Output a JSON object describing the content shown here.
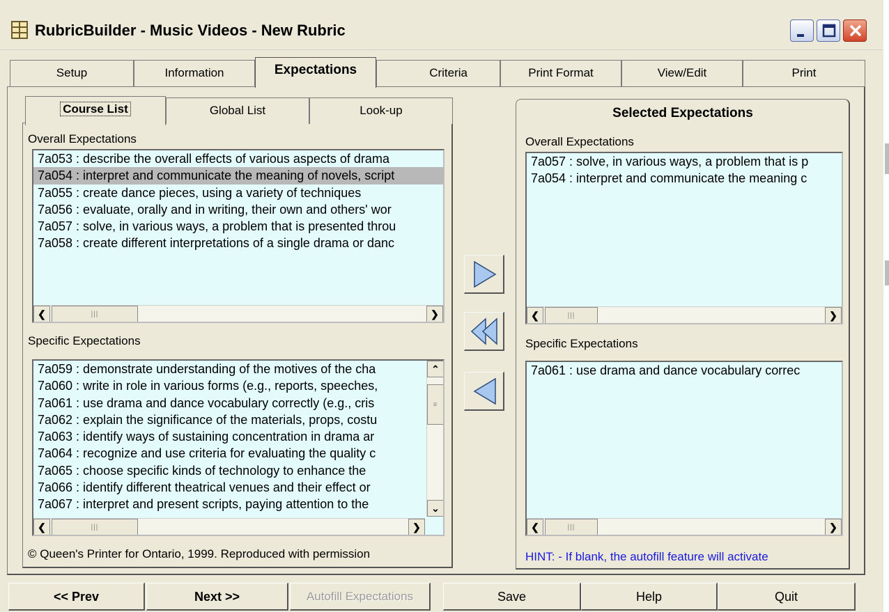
{
  "window": {
    "title": "RubricBuilder  - Music Videos - New Rubric",
    "icon": "app-grid-icon"
  },
  "main_tabs": [
    {
      "label": "Setup"
    },
    {
      "label": "Information"
    },
    {
      "label": "Expectations",
      "active": true
    },
    {
      "label": "Criteria"
    },
    {
      "label": "Print Format"
    },
    {
      "label": "View/Edit"
    },
    {
      "label": "Print"
    }
  ],
  "sub_tabs": [
    {
      "label": "Course List",
      "active": true
    },
    {
      "label": "Global List"
    },
    {
      "label": "Look-up"
    }
  ],
  "left": {
    "overall_label": "Overall Expectations",
    "overall_items": [
      "7a053 : describe the overall effects of various aspects of drama",
      "7a054 : interpret and communicate the meaning of novels, script",
      "7a055 : create dance pieces, using a variety of techniques",
      "7a056 : evaluate, orally and in writing, their own and others' wor",
      "7a057 : solve, in various ways, a problem that is presented throu",
      "7a058 : create different interpretations of a single drama or danc"
    ],
    "overall_selected_index": 1,
    "specific_label": "Specific Expectations",
    "specific_items": [
      "7a059 : demonstrate understanding of the motives of the cha",
      "7a060 : write in role in various forms (e.g., reports, speeches,",
      "7a061 : use drama and dance vocabulary correctly (e.g., cris",
      "7a062 : explain the significance of the materials, props, costu",
      "7a063 : identify ways of sustaining concentration in drama ar",
      "7a064 : recognize and use criteria for evaluating the quality c",
      "7a065 : choose specific kinds of technology to enhance the",
      "7a066 : identify different theatrical venues and their effect or",
      "7a067 : interpret and present scripts, paying attention to the"
    ]
  },
  "right": {
    "title": "Selected Expectations",
    "overall_label": "Overall Expectations",
    "overall_items": [
      "7a057 : solve, in various ways, a problem that is p",
      "7a054 : interpret and communicate the meaning c"
    ],
    "specific_label": "Specific Expectations",
    "specific_items": [
      "7a061 : use drama and dance vocabulary correc"
    ]
  },
  "transfer_buttons": {
    "add": "add-right-arrow-icon",
    "remove_all": "remove-all-double-left-icon",
    "remove": "remove-left-arrow-icon"
  },
  "footer": {
    "copyright": "© Queen's Printer for Ontario, 1999. Reproduced with permission",
    "hint": "HINT: - If blank, the autofill feature will activate"
  },
  "buttons": {
    "prev": "<< Prev",
    "next": "Next >>",
    "autofill": "Autofill Expectations",
    "save": "Save",
    "help": "Help",
    "quit": "Quit"
  },
  "colors": {
    "list_bg": "#e4fbfb",
    "selection": "#b8b8b8",
    "hint_text": "#1a1adc",
    "arrow_fill": "#a8c8f0"
  }
}
